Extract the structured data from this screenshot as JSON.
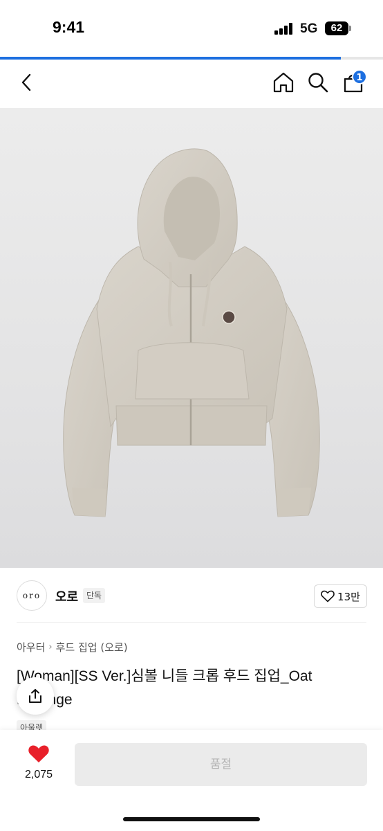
{
  "status_bar": {
    "time": "9:41",
    "network": "5G",
    "battery": "62"
  },
  "page_progress": 0.89,
  "nav": {
    "cart_badge": "1"
  },
  "brand": {
    "logo_text": "oro",
    "name": "오로",
    "tag": "단독",
    "likes": "13만"
  },
  "breadcrumb": [
    "아우터",
    "후드 집업 (오로)"
  ],
  "product": {
    "title": "[Woman][SS Ver.]심볼 니들 크롭 후드 집업_Oat Melange",
    "tag": "아울렛"
  },
  "bottom_bar": {
    "wish_count": "2,075",
    "buy_label": "품절"
  },
  "colors": {
    "accent": "#1d6fe0",
    "heart": "#e8202a",
    "disabled_bg": "#ebebeb"
  }
}
